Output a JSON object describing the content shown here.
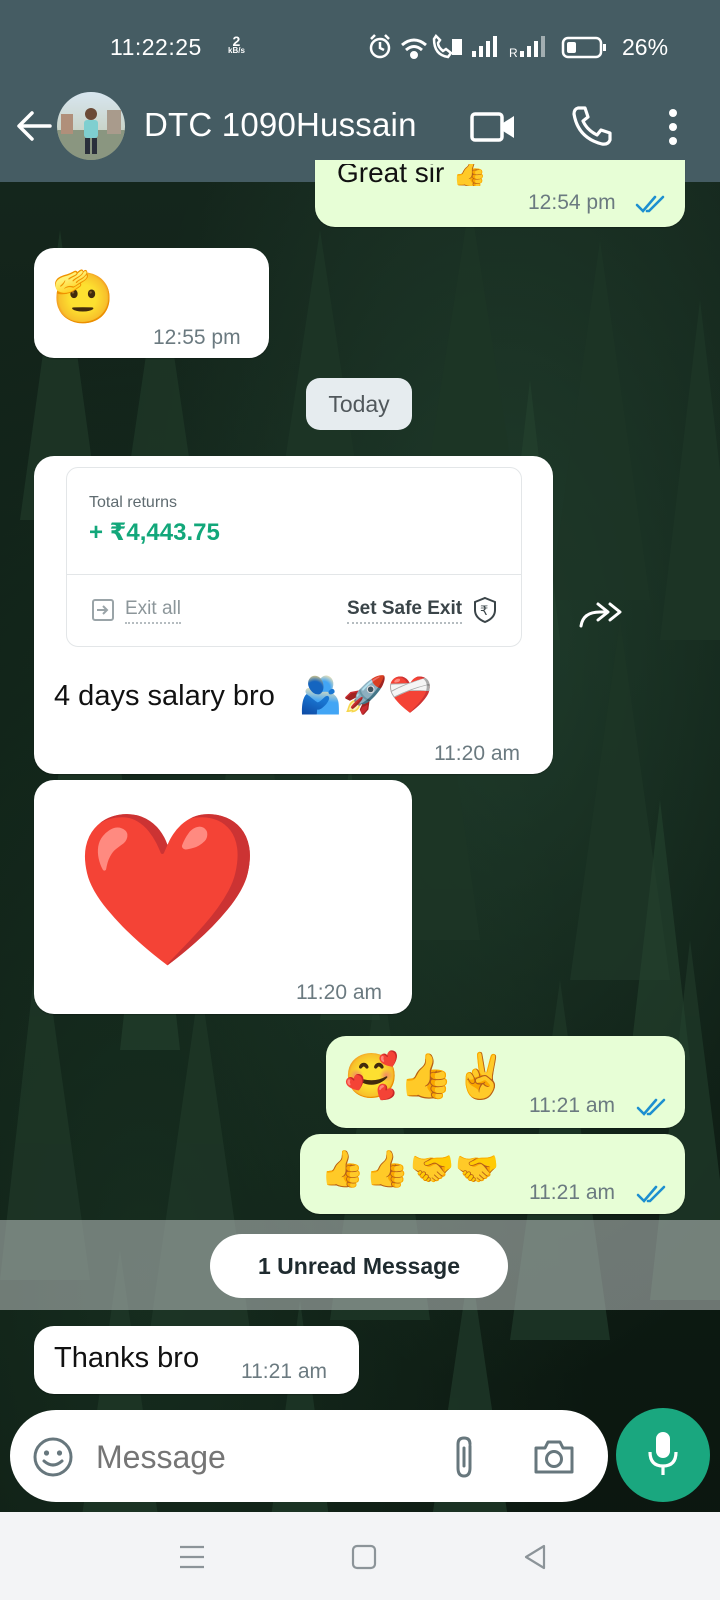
{
  "status_bar": {
    "time": "11:22:25",
    "net_speed_value": "2",
    "net_speed_unit": "kB/s",
    "battery": "26%"
  },
  "header": {
    "contact_name": "DTC 1090Hussain",
    "icons": [
      "back-arrow-icon",
      "video-call-icon",
      "phone-icon",
      "more-icon"
    ]
  },
  "messages": [
    {
      "direction": "out",
      "text": "Great sir 👍",
      "time": "12:54 pm",
      "status": "read"
    },
    {
      "direction": "in",
      "emoji": "🫡",
      "time": "12:55 pm"
    },
    {
      "date_chip": "Today"
    },
    {
      "direction": "in",
      "card": {
        "label": "Total returns",
        "value": "+ ₹4,443.75",
        "exit_all": "Exit all",
        "safe_exit": "Set Safe Exit"
      },
      "text": "4 days salary bro",
      "text_emoji": "🫂🚀❤️‍🩹",
      "time": "11:20 am"
    },
    {
      "direction": "in",
      "emoji": "❤️",
      "time": "11:20 am"
    },
    {
      "direction": "out",
      "emoji": "🥰👍✌️",
      "time": "11:21 am",
      "status": "read"
    },
    {
      "direction": "out",
      "emoji": "👍👍🤝🤝",
      "time": "11:21 am",
      "status": "read"
    },
    {
      "unread_banner": "1 Unread Message"
    },
    {
      "direction": "in",
      "text": "Thanks bro",
      "time": "11:21 am"
    }
  ],
  "composer": {
    "placeholder": "Message"
  },
  "colors": {
    "header": "#455c63",
    "outgoing": "#e7fed6",
    "incoming": "#ffffff",
    "accent": "#1aa77f",
    "tick": "#1d8fd0"
  }
}
